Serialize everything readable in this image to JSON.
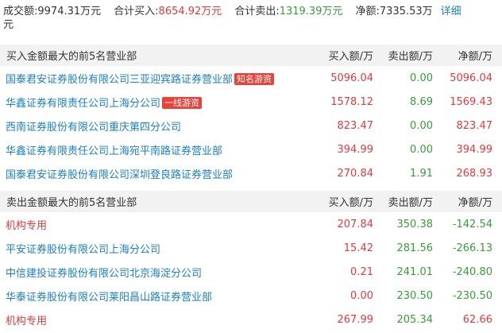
{
  "summary": {
    "turnover_label": "成交额:",
    "turnover_value": "9974.31万元",
    "buy_label": "合计买入:",
    "buy_value": "8654.92万元",
    "sell_label": "合计卖出:",
    "sell_value": "1319.39万元",
    "net_label": "净额:",
    "net_value": "7335.53万",
    "detail_link": "详细",
    "wrap_char": "元"
  },
  "buy_section": {
    "title": "买入金额最大的前5名营业部",
    "col_buy": "买入额/万",
    "col_sell": "卖出额/万",
    "col_net": "净额/万",
    "rows": [
      {
        "name": "国泰君安证券股份有限公司三亚迎宾路证券营业部",
        "badge": "知名游资",
        "buy": "5096.04",
        "sell": "0.00",
        "net": "5096.04"
      },
      {
        "name": "华鑫证券有限责任公司上海分公司",
        "badge": "一线游资",
        "buy": "1578.12",
        "sell": "8.69",
        "net": "1569.43"
      },
      {
        "name": "西南证券股份有限公司重庆第四分公司",
        "badge": "",
        "buy": "823.47",
        "sell": "0.00",
        "net": "823.47"
      },
      {
        "name": "华鑫证券有限责任公司上海宛平南路证券营业部",
        "badge": "",
        "buy": "394.99",
        "sell": "0.00",
        "net": "394.99"
      },
      {
        "name": "国泰君安证券股份有限公司深圳登良路证券营业部",
        "badge": "",
        "buy": "270.84",
        "sell": "1.91",
        "net": "268.93"
      }
    ]
  },
  "sell_section": {
    "title": "卖出金额最大的前5名营业部",
    "col_buy": "买入额/万",
    "col_sell": "卖出额/万",
    "col_net": "净额/万",
    "rows": [
      {
        "name": "机构专用",
        "institution": true,
        "buy": "207.84",
        "sell": "350.38",
        "net": "-142.54"
      },
      {
        "name": "平安证券股份有限公司上海分公司",
        "institution": false,
        "buy": "15.42",
        "sell": "281.56",
        "net": "-266.13"
      },
      {
        "name": "中信建投证券股份有限公司北京海淀分公司",
        "institution": false,
        "buy": "0.21",
        "sell": "241.01",
        "net": "-240.80"
      },
      {
        "name": "华泰证券股份有限公司莱阳昌山路证券营业部",
        "institution": false,
        "buy": "0.00",
        "sell": "230.50",
        "net": "-230.50"
      },
      {
        "name": "机构专用",
        "institution": true,
        "buy": "267.99",
        "sell": "205.34",
        "net": "62.66"
      }
    ]
  },
  "colors": {
    "red": "#e03b3b",
    "green": "#3a9b3a",
    "blue_link": "#1a7fc5",
    "badge_bg": "#e8433a",
    "header_bg": "#f2f2f2"
  }
}
